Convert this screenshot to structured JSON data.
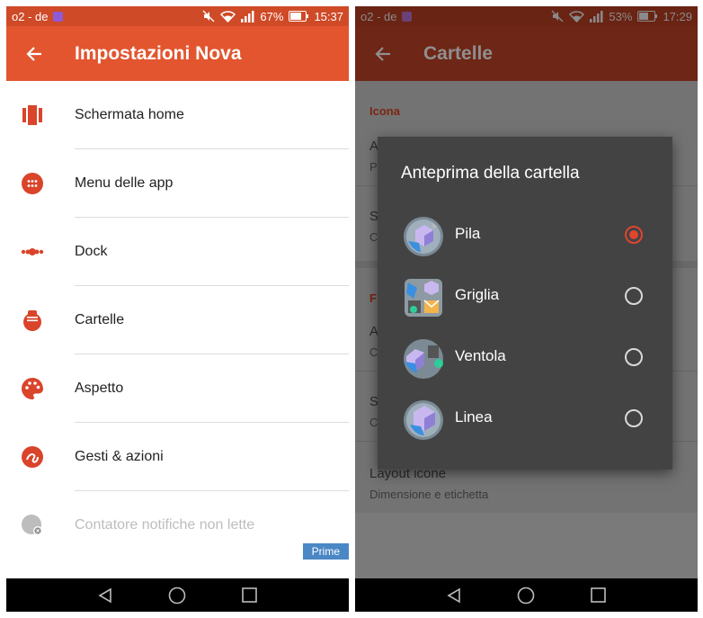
{
  "left": {
    "status": {
      "carrier": "o2 - de",
      "battery": "67%",
      "time": "15:37"
    },
    "appbar": {
      "title": "Impostazioni Nova"
    },
    "items": [
      {
        "label": "Schermata home",
        "icon": "home-screen-icon"
      },
      {
        "label": "Menu delle app",
        "icon": "app-drawer-icon"
      },
      {
        "label": "Dock",
        "icon": "dock-icon"
      },
      {
        "label": "Cartelle",
        "icon": "folder-icon"
      },
      {
        "label": "Aspetto",
        "icon": "palette-icon"
      },
      {
        "label": "Gesti & azioni",
        "icon": "gestures-icon"
      },
      {
        "label": "Contatore notifiche non lette",
        "icon": "notification-counter-icon",
        "badge": "Prime"
      }
    ]
  },
  "right": {
    "status": {
      "carrier": "o2 - de",
      "battery": "53%",
      "time": "17:29"
    },
    "appbar": {
      "title": "Cartelle"
    },
    "background": {
      "section_icona": "Icona",
      "row1_title": "A",
      "row1_sub": "P",
      "row2_title": "S",
      "row2_sub": "C",
      "section_f": "F",
      "row3_title": "A",
      "row3_sub": "C",
      "row4_title": "S",
      "row4_sub": "C",
      "row5_title": "Layout icone",
      "row5_sub": "Dimensione e etichetta"
    },
    "dialog": {
      "title": "Anteprima della cartella",
      "options": [
        {
          "label": "Pila",
          "selected": true
        },
        {
          "label": "Griglia",
          "selected": false
        },
        {
          "label": "Ventola",
          "selected": false
        },
        {
          "label": "Linea",
          "selected": false
        }
      ]
    }
  },
  "colors": {
    "accent": "#e2552f",
    "icon_red": "#d9442b",
    "prime_blue": "#4a87c5"
  }
}
